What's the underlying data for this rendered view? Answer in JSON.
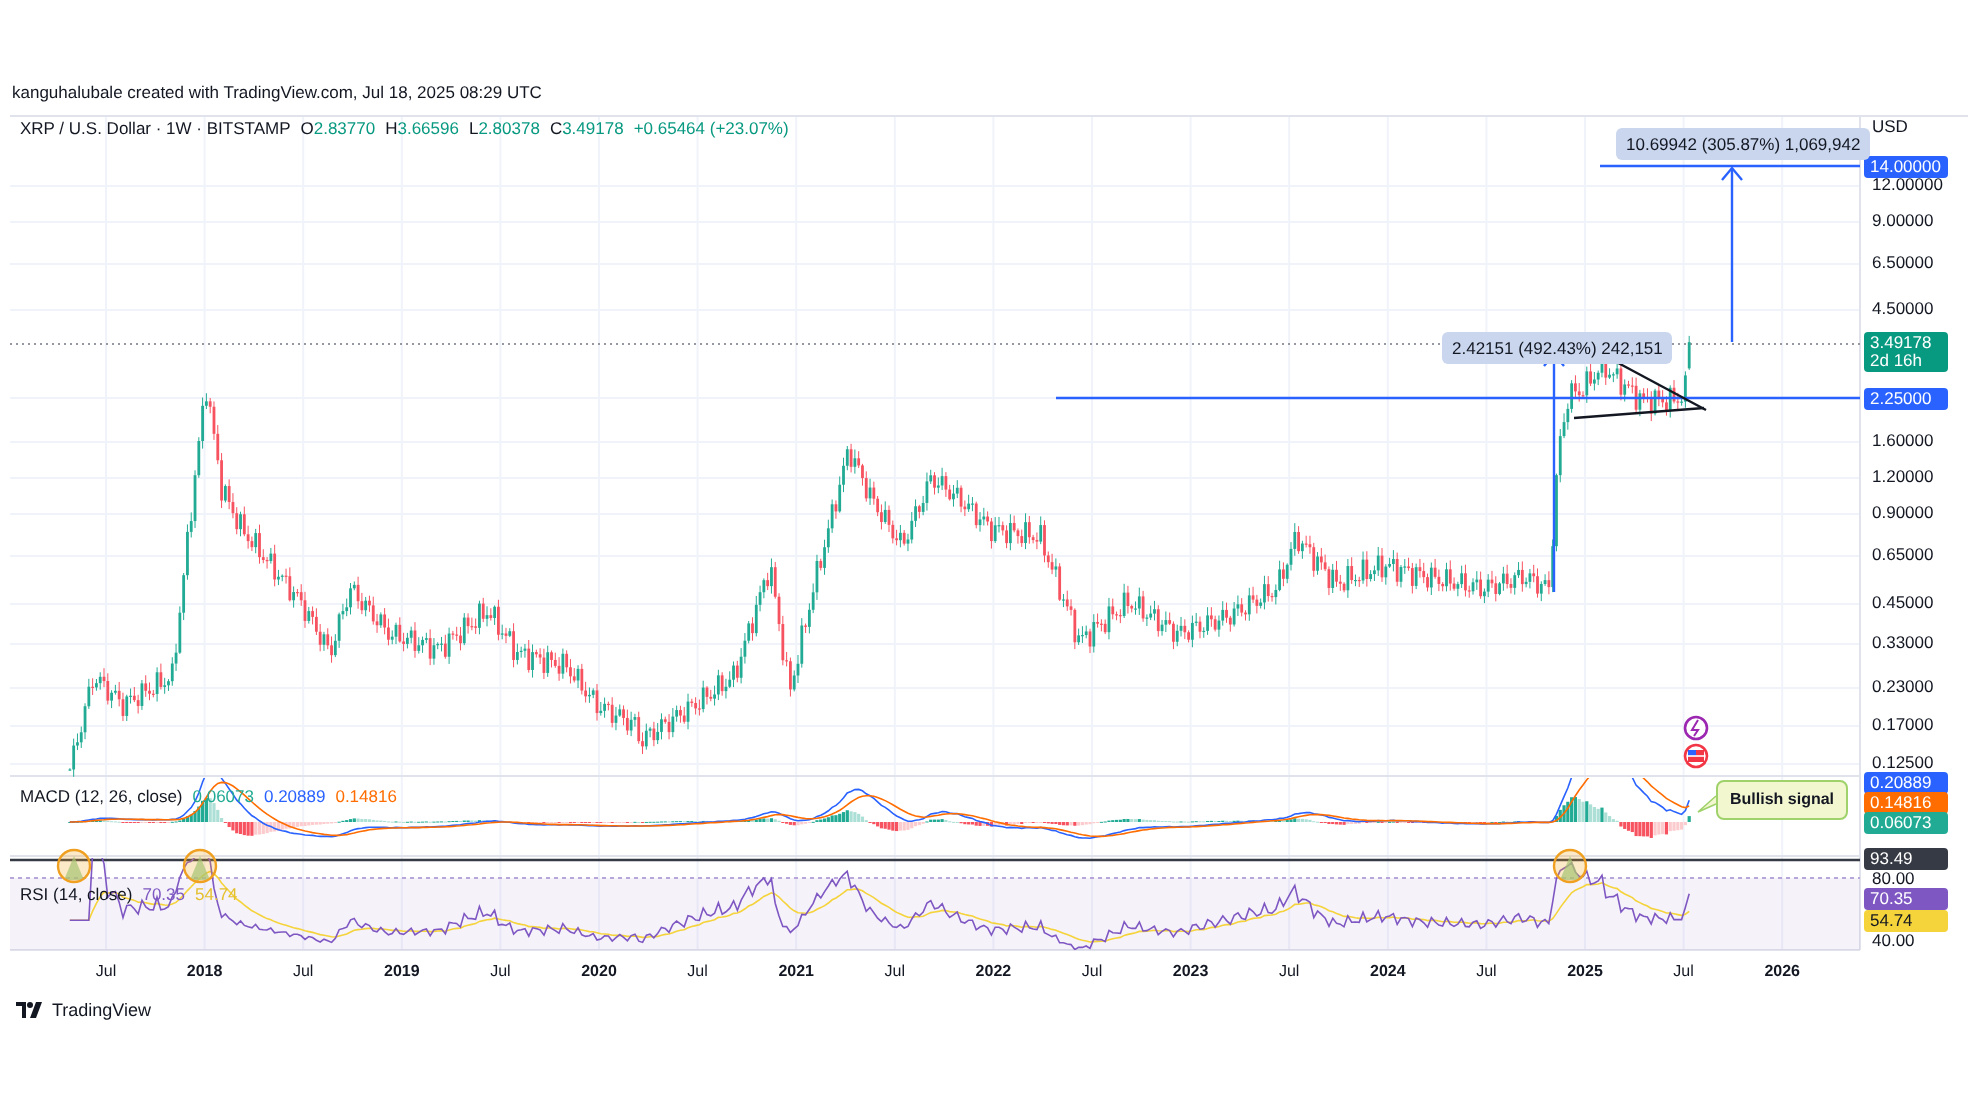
{
  "attribution": "kanguhalubale created with TradingView.com, Jul 18, 2025 08:29 UTC",
  "symbol": {
    "title": "XRP / U.S. Dollar · 1W · BITSTAMP",
    "ohlc": [
      {
        "label": "O",
        "value": "2.83770"
      },
      {
        "label": "H",
        "value": "3.66596"
      },
      {
        "label": "L",
        "value": "2.80378"
      },
      {
        "label": "C",
        "value": "3.49178"
      }
    ],
    "change": "+0.65464 (+23.07%)"
  },
  "price_axis": {
    "currency": "USD",
    "labels": [
      "12.00000",
      "9.00000",
      "6.50000",
      "4.50000",
      "1.60000",
      "1.20000",
      "0.90000",
      "0.65000",
      "0.45000",
      "0.33000",
      "0.23000",
      "0.17000",
      "0.12500"
    ],
    "tags": [
      {
        "text": "14.00000",
        "color": "#2962ff"
      },
      {
        "text": "3.49178",
        "sub": "2d 16h",
        "color": "#089981"
      },
      {
        "text": "2.25000",
        "color": "#2962ff"
      }
    ]
  },
  "measurements": [
    {
      "text": "10.69942 (305.87%) 1,069,942"
    },
    {
      "text": "2.42151 (492.43%) 242,151"
    }
  ],
  "signal_callout": "Bullish signal",
  "macd": {
    "title": "MACD (12, 26, close)",
    "values": [
      {
        "text": "0.06073",
        "color": "#22ab94"
      },
      {
        "text": "0.20889",
        "color": "#2962ff"
      },
      {
        "text": "0.14816",
        "color": "#ff6d00"
      }
    ],
    "tags": [
      {
        "text": "0.20889",
        "color": "#2962ff"
      },
      {
        "text": "0.14816",
        "color": "#ff6d00"
      },
      {
        "text": "0.06073",
        "color": "#22ab94"
      }
    ]
  },
  "rsi": {
    "title": "RSI (14, close)",
    "values": [
      {
        "text": "70.35",
        "color": "#7e57c2"
      },
      {
        "text": "54.74",
        "color": "#e5c02e"
      }
    ],
    "labels": [
      "80.00",
      "40.00"
    ],
    "tags": [
      {
        "text": "93.49",
        "color": "#363a45"
      },
      {
        "text": "70.35",
        "color": "#7e57c2"
      },
      {
        "text": "54.74",
        "color": "#f5d33a"
      }
    ]
  },
  "time_axis": [
    {
      "text": "Jul",
      "kind": "month"
    },
    {
      "text": "2018",
      "kind": "year"
    },
    {
      "text": "Jul",
      "kind": "month"
    },
    {
      "text": "2019",
      "kind": "year"
    },
    {
      "text": "Jul",
      "kind": "month"
    },
    {
      "text": "2020",
      "kind": "year"
    },
    {
      "text": "Jul",
      "kind": "month"
    },
    {
      "text": "2021",
      "kind": "year"
    },
    {
      "text": "Jul",
      "kind": "month"
    },
    {
      "text": "2022",
      "kind": "year"
    },
    {
      "text": "Jul",
      "kind": "month"
    },
    {
      "text": "2023",
      "kind": "year"
    },
    {
      "text": "Jul",
      "kind": "month"
    },
    {
      "text": "2024",
      "kind": "year"
    },
    {
      "text": "Jul",
      "kind": "month"
    },
    {
      "text": "2025",
      "kind": "year"
    },
    {
      "text": "Jul",
      "kind": "month"
    },
    {
      "text": "2026",
      "kind": "year"
    }
  ],
  "footer": {
    "brand": "TradingView"
  }
}
